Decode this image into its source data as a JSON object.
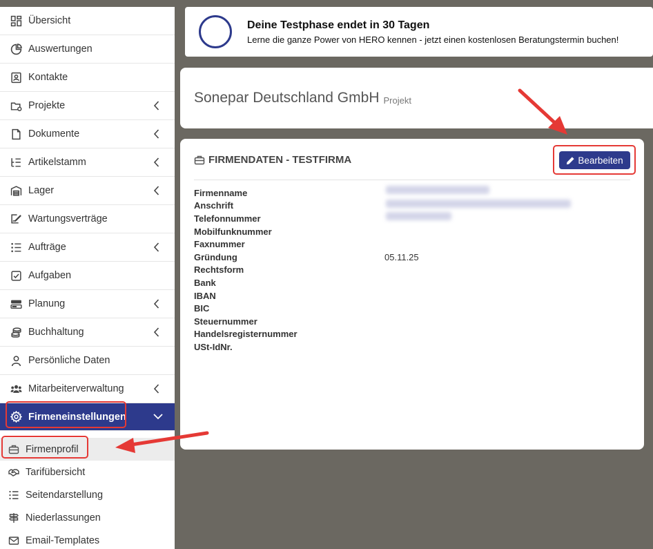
{
  "sidebar": {
    "items": [
      {
        "label": "Übersicht",
        "icon": "dashboard-icon",
        "chevron": false
      },
      {
        "label": "Auswertungen",
        "icon": "pie-chart-icon",
        "chevron": false
      },
      {
        "label": "Kontakte",
        "icon": "contact-card-icon",
        "chevron": false
      },
      {
        "label": "Projekte",
        "icon": "folder-icon",
        "chevron": true
      },
      {
        "label": "Dokumente",
        "icon": "document-icon",
        "chevron": true
      },
      {
        "label": "Artikelstamm",
        "icon": "list-tree-icon",
        "chevron": true
      },
      {
        "label": "Lager",
        "icon": "warehouse-icon",
        "chevron": true
      },
      {
        "label": "Wartungsverträge",
        "icon": "contract-sign-icon",
        "chevron": false
      },
      {
        "label": "Aufträge",
        "icon": "task-list-icon",
        "chevron": true
      },
      {
        "label": "Aufgaben",
        "icon": "checkbox-icon",
        "chevron": false
      },
      {
        "label": "Planung",
        "icon": "planning-icon",
        "chevron": true
      },
      {
        "label": "Buchhaltung",
        "icon": "coins-icon",
        "chevron": true
      },
      {
        "label": "Persönliche Daten",
        "icon": "user-icon",
        "chevron": false
      },
      {
        "label": "Mitarbeiterverwaltung",
        "icon": "users-icon",
        "chevron": true
      },
      {
        "label": "Firmeneinstellungen",
        "icon": "gear-icon",
        "chevron": true,
        "active": true
      }
    ],
    "sub_items": [
      {
        "label": "Firmenprofil",
        "icon": "briefcase-icon",
        "selected": true
      },
      {
        "label": "Tarifübersicht",
        "icon": "handshake-icon"
      },
      {
        "label": "Seitendarstellung",
        "icon": "list-icon"
      },
      {
        "label": "Niederlassungen",
        "icon": "signpost-icon"
      },
      {
        "label": "Email-Templates",
        "icon": "envelope-icon"
      }
    ]
  },
  "banner": {
    "title": "Deine Testphase endet in 30 Tagen",
    "subtitle": "Lerne die ganze Power von HERO kennen - jetzt einen kostenlosen Beratungstermin buchen!"
  },
  "project": {
    "company": "Sonepar Deutschland GmbH",
    "type": "Projekt"
  },
  "company_data": {
    "heading": "FIRMENDATEN - TESTFIRMA",
    "edit_label": "Bearbeiten",
    "fields": [
      {
        "label": "Firmenname",
        "value": ""
      },
      {
        "label": "Anschrift",
        "value": ""
      },
      {
        "label": "Telefonnummer",
        "value": ""
      },
      {
        "label": "Mobilfunknummer",
        "value": ""
      },
      {
        "label": "Faxnummer",
        "value": ""
      },
      {
        "label": "Gründung",
        "value": "05.11.25"
      },
      {
        "label": "Rechtsform",
        "value": ""
      },
      {
        "label": "Bank",
        "value": ""
      },
      {
        "label": "IBAN",
        "value": ""
      },
      {
        "label": "BIC",
        "value": ""
      },
      {
        "label": "Steuernummer",
        "value": ""
      },
      {
        "label": "Handelsregisternummer",
        "value": ""
      },
      {
        "label": "USt-IdNr.",
        "value": ""
      }
    ]
  },
  "colors": {
    "primary": "#2d3a8c",
    "background": "#6b6861",
    "highlight": "#e53935"
  }
}
